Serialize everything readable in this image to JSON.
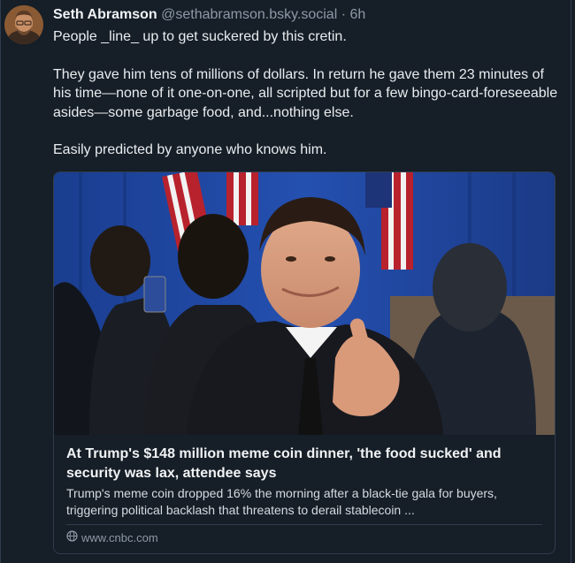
{
  "post": {
    "author_name": "Seth Abramson",
    "author_handle": "@sethabramson.bsky.social",
    "separator": "·",
    "time": "6h",
    "paragraphs": [
      "People _line_ up to get suckered by this cretin.",
      "They gave him tens of millions of dollars. In return he gave them 23 minutes of his time—none of it one-on-one, all scripted but for a few bingo-card-foreseeable asides—some garbage food, and...nothing else.",
      "Easily predicted by anyone who knows him."
    ]
  },
  "link_card": {
    "title": "At Trump's $148 million meme coin dinner, 'the food sucked' and security was lax, attendee says",
    "description": "Trump's meme coin dropped 16% the morning after a black-tie gala for buyers, triggering political backlash that threatens to derail stablecoin ...",
    "domain": "www.cnbc.com",
    "image_icon": "photo-of-man-giving-thumbs-up",
    "source_icon": "globe-icon"
  },
  "colors": {
    "background": "#161e27",
    "border": "#2e3d4d",
    "muted_text": "#8d9aa8"
  }
}
